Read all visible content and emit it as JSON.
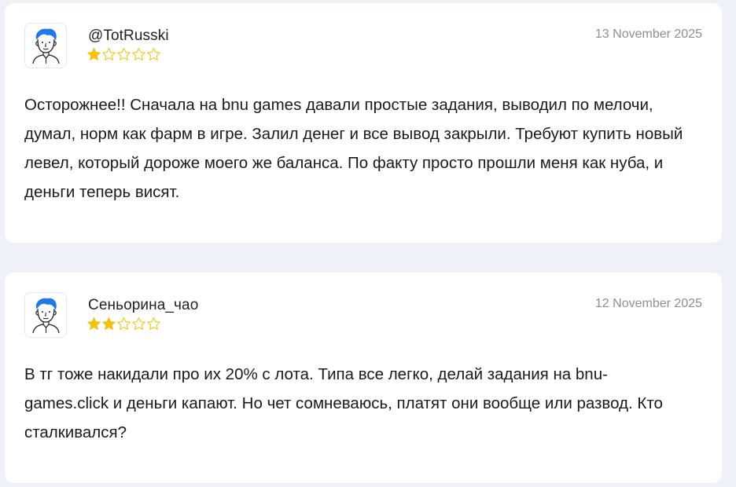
{
  "reviews": [
    {
      "username": "@TotRusski",
      "date": "13 November 2025",
      "rating": 1,
      "max_rating": 5,
      "text": "Осторожнее!! Сначала на bnu games давали простые задания, выводил по мелочи, думал, норм как фарм в игре. Залил денег и все вывод закрыли. Требуют купить новый левел, который дороже моего же баланса. По факту просто прошли меня как нуба, и деньги теперь висят."
    },
    {
      "username": "Сеньорина_чао",
      "date": "12 November 2025",
      "rating": 2,
      "max_rating": 5,
      "text": "В тг тоже накидали про их 20% с лота. Типа все легко, делай задания на bnu- games.click и деньги капают. Но чет сомневаюсь, платят они вообще или развод. Кто сталкивался?"
    }
  ],
  "colors": {
    "star_filled": "#f2c40f",
    "star_empty_stroke": "#f2c40f",
    "avatar_hair": "#1e7be6",
    "page_background": "#eef2f8",
    "card_background": "#ffffff",
    "date_text": "#8a8f99"
  },
  "icons": {
    "avatar": "user-avatar-icon",
    "star": "star-icon"
  }
}
